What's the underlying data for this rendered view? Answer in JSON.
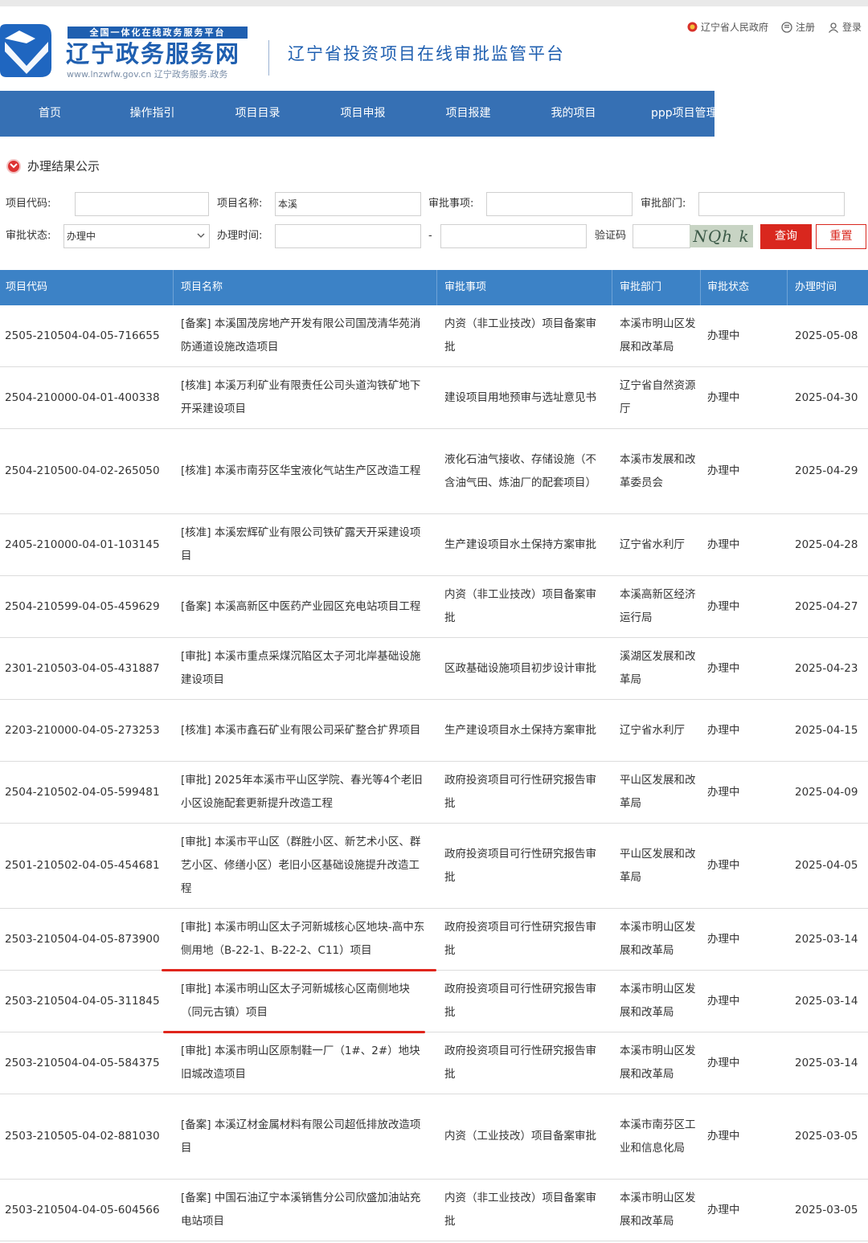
{
  "header": {
    "slogan": "全国一体化在线政务服务平台",
    "site_name": "辽宁政务服务网",
    "site_url": "www.lnzwfw.gov.cn  辽宁政务服务.政务",
    "platform_title": "辽宁省投资项目在线审批监管平台",
    "links": [
      {
        "label": "辽宁省人民政府",
        "icon": "emblem-icon"
      },
      {
        "label": "注册",
        "icon": "register-icon"
      },
      {
        "label": "登录",
        "icon": "user-icon"
      }
    ]
  },
  "nav": {
    "items": [
      "首页",
      "操作指引",
      "项目目录",
      "项目申报",
      "项目报建",
      "我的项目",
      "ppp项目管理"
    ]
  },
  "section": {
    "title": "办理结果公示"
  },
  "form": {
    "project_code_label": "项目代码:",
    "project_code_value": "",
    "project_name_label": "项目名称:",
    "project_name_value": "本溪",
    "approval_item_label": "审批事项:",
    "approval_item_value": "",
    "approval_dept_label": "审批部门:",
    "approval_dept_value": "",
    "status_label": "审批状态:",
    "status_value": "办理中",
    "time_label": "办理时间:",
    "time_start": "",
    "time_separator": "-",
    "time_end": "",
    "captcha_label": "验证码",
    "captcha_value": "",
    "captcha_text": "NQh k",
    "query_button": "查询",
    "reset_button": "重置"
  },
  "table": {
    "headers": [
      "项目代码",
      "项目名称",
      "审批事项",
      "审批部门",
      "审批状态",
      "办理时间"
    ],
    "rows": [
      {
        "code": "2505-210504-04-05-716655",
        "name": "[备案] 本溪国茂房地产开发有限公司国茂清华苑消防通道设施改造项目",
        "item": "内资（非工业技改）项目备案审批",
        "dept": "本溪市明山区发展和改革局",
        "status": "办理中",
        "date": "2025-05-08"
      },
      {
        "code": "2504-210000-04-01-400338",
        "name": "[核准] 本溪万利矿业有限责任公司头道沟铁矿地下开采建设项目",
        "item": "建设项目用地预审与选址意见书",
        "dept": "辽宁省自然资源厅",
        "status": "办理中",
        "date": "2025-04-30"
      },
      {
        "code": "2504-210500-04-02-265050",
        "name": "[核准] 本溪市南芬区华宝液化气站生产区改造工程",
        "item": "液化石油气接收、存储设施（不含油气田、炼油厂的配套项目）",
        "dept": "本溪市发展和改革委员会",
        "status": "办理中",
        "date": "2025-04-29"
      },
      {
        "code": "2405-210000-04-01-103145",
        "name": "[核准] 本溪宏辉矿业有限公司铁矿露天开采建设项目",
        "item": "生产建设项目水土保持方案审批",
        "dept": "辽宁省水利厅",
        "status": "办理中",
        "date": "2025-04-28"
      },
      {
        "code": "2504-210599-04-05-459629",
        "name": "[备案] 本溪高新区中医药产业园区充电站项目工程",
        "item": "内资（非工业技改）项目备案审批",
        "dept": "本溪高新区经济运行局",
        "status": "办理中",
        "date": "2025-04-27"
      },
      {
        "code": "2301-210503-04-05-431887",
        "name": "[审批] 本溪市重点采煤沉陷区太子河北岸基础设施建设项目",
        "item": "区政基础设施项目初步设计审批",
        "dept": "溪湖区发展和改革局",
        "status": "办理中",
        "date": "2025-04-23"
      },
      {
        "code": "2203-210000-04-05-273253",
        "name": "[核准] 本溪市鑫石矿业有限公司采矿整合扩界项目",
        "item": "生产建设项目水土保持方案审批",
        "dept": "辽宁省水利厅",
        "status": "办理中",
        "date": "2025-04-15"
      },
      {
        "code": "2504-210502-04-05-599481",
        "name": "[审批] 2025年本溪市平山区学院、春光等4个老旧小区设施配套更新提升改造工程",
        "item": "政府投资项目可行性研究报告审批",
        "dept": "平山区发展和改革局",
        "status": "办理中",
        "date": "2025-04-09"
      },
      {
        "code": "2501-210502-04-05-454681",
        "name": "[审批] 本溪市平山区（群胜小区、新艺术小区、群艺小区、修缮小区）老旧小区基础设施提升改造工程",
        "item": "政府投资项目可行性研究报告审批",
        "dept": "平山区发展和改革局",
        "status": "办理中",
        "date": "2025-04-05"
      },
      {
        "code": "2503-210504-04-05-873900",
        "name": "[审批] 本溪市明山区太子河新城核心区地块-高中东侧用地（B-22-1、B-22-2、C11）项目",
        "item": "政府投资项目可行性研究报告审批",
        "dept": "本溪市明山区发展和改革局",
        "status": "办理中",
        "date": "2025-03-14"
      },
      {
        "code": "2503-210504-04-05-311845",
        "name": "[审批] 本溪市明山区太子河新城核心区南侧地块（同元古镇）项目",
        "item": "政府投资项目可行性研究报告审批",
        "dept": "本溪市明山区发展和改革局",
        "status": "办理中",
        "date": "2025-03-14"
      },
      {
        "code": "2503-210504-04-05-584375",
        "name": "[审批] 本溪市明山区原制鞋一厂（1#、2#）地块旧城改造项目",
        "item": "政府投资项目可行性研究报告审批",
        "dept": "本溪市明山区发展和改革局",
        "status": "办理中",
        "date": "2025-03-14"
      },
      {
        "code": "2503-210505-04-02-881030",
        "name": "[备案] 本溪辽材金属材料有限公司超低排放改造项目",
        "item": "内资（工业技改）项目备案审批",
        "dept": "本溪市南芬区工业和信息化局",
        "status": "办理中",
        "date": "2025-03-05"
      },
      {
        "code": "2503-210504-04-05-604566",
        "name": "[备案] 中国石油辽宁本溪销售分公司欣盛加油站充电站项目",
        "item": "内资（非工业技改）项目备案审批",
        "dept": "本溪市明山区发展和改革局",
        "status": "办理中",
        "date": "2025-03-05"
      }
    ]
  }
}
